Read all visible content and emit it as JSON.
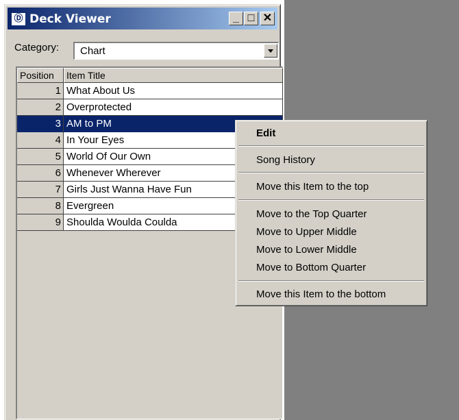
{
  "window": {
    "title": "Deck Viewer",
    "icon_glyph": "ᑀᑀ",
    "controls": {
      "minimize": "_",
      "maximize": "□",
      "close": "✕"
    }
  },
  "category": {
    "label": "Category:",
    "value": "Chart"
  },
  "list": {
    "headers": {
      "position": "Position",
      "title": "Item Title"
    },
    "rows": [
      {
        "position": "1",
        "title": "What About Us"
      },
      {
        "position": "2",
        "title": "Overprotected"
      },
      {
        "position": "3",
        "title": "AM to PM",
        "selected": true
      },
      {
        "position": "4",
        "title": "In Your Eyes"
      },
      {
        "position": "5",
        "title": "World Of Our Own"
      },
      {
        "position": "6",
        "title": "Whenever Wherever"
      },
      {
        "position": "7",
        "title": "Girls Just Wanna Have Fun"
      },
      {
        "position": "8",
        "title": "Evergreen"
      },
      {
        "position": "9",
        "title": "Shoulda Woulda Coulda"
      }
    ]
  },
  "context_menu": {
    "edit": "Edit",
    "song_history": "Song History",
    "move_top": "Move this Item to the top",
    "move_top_quarter": "Move to the Top Quarter",
    "move_upper_middle": "Move to Upper Middle",
    "move_lower_middle": "Move to Lower Middle",
    "move_bottom_quarter": "Move to Bottom Quarter",
    "move_bottom": "Move this Item to the bottom"
  },
  "colors": {
    "selection": "#0a246a",
    "face": "#d4d0c8",
    "desktop": "#808080"
  }
}
